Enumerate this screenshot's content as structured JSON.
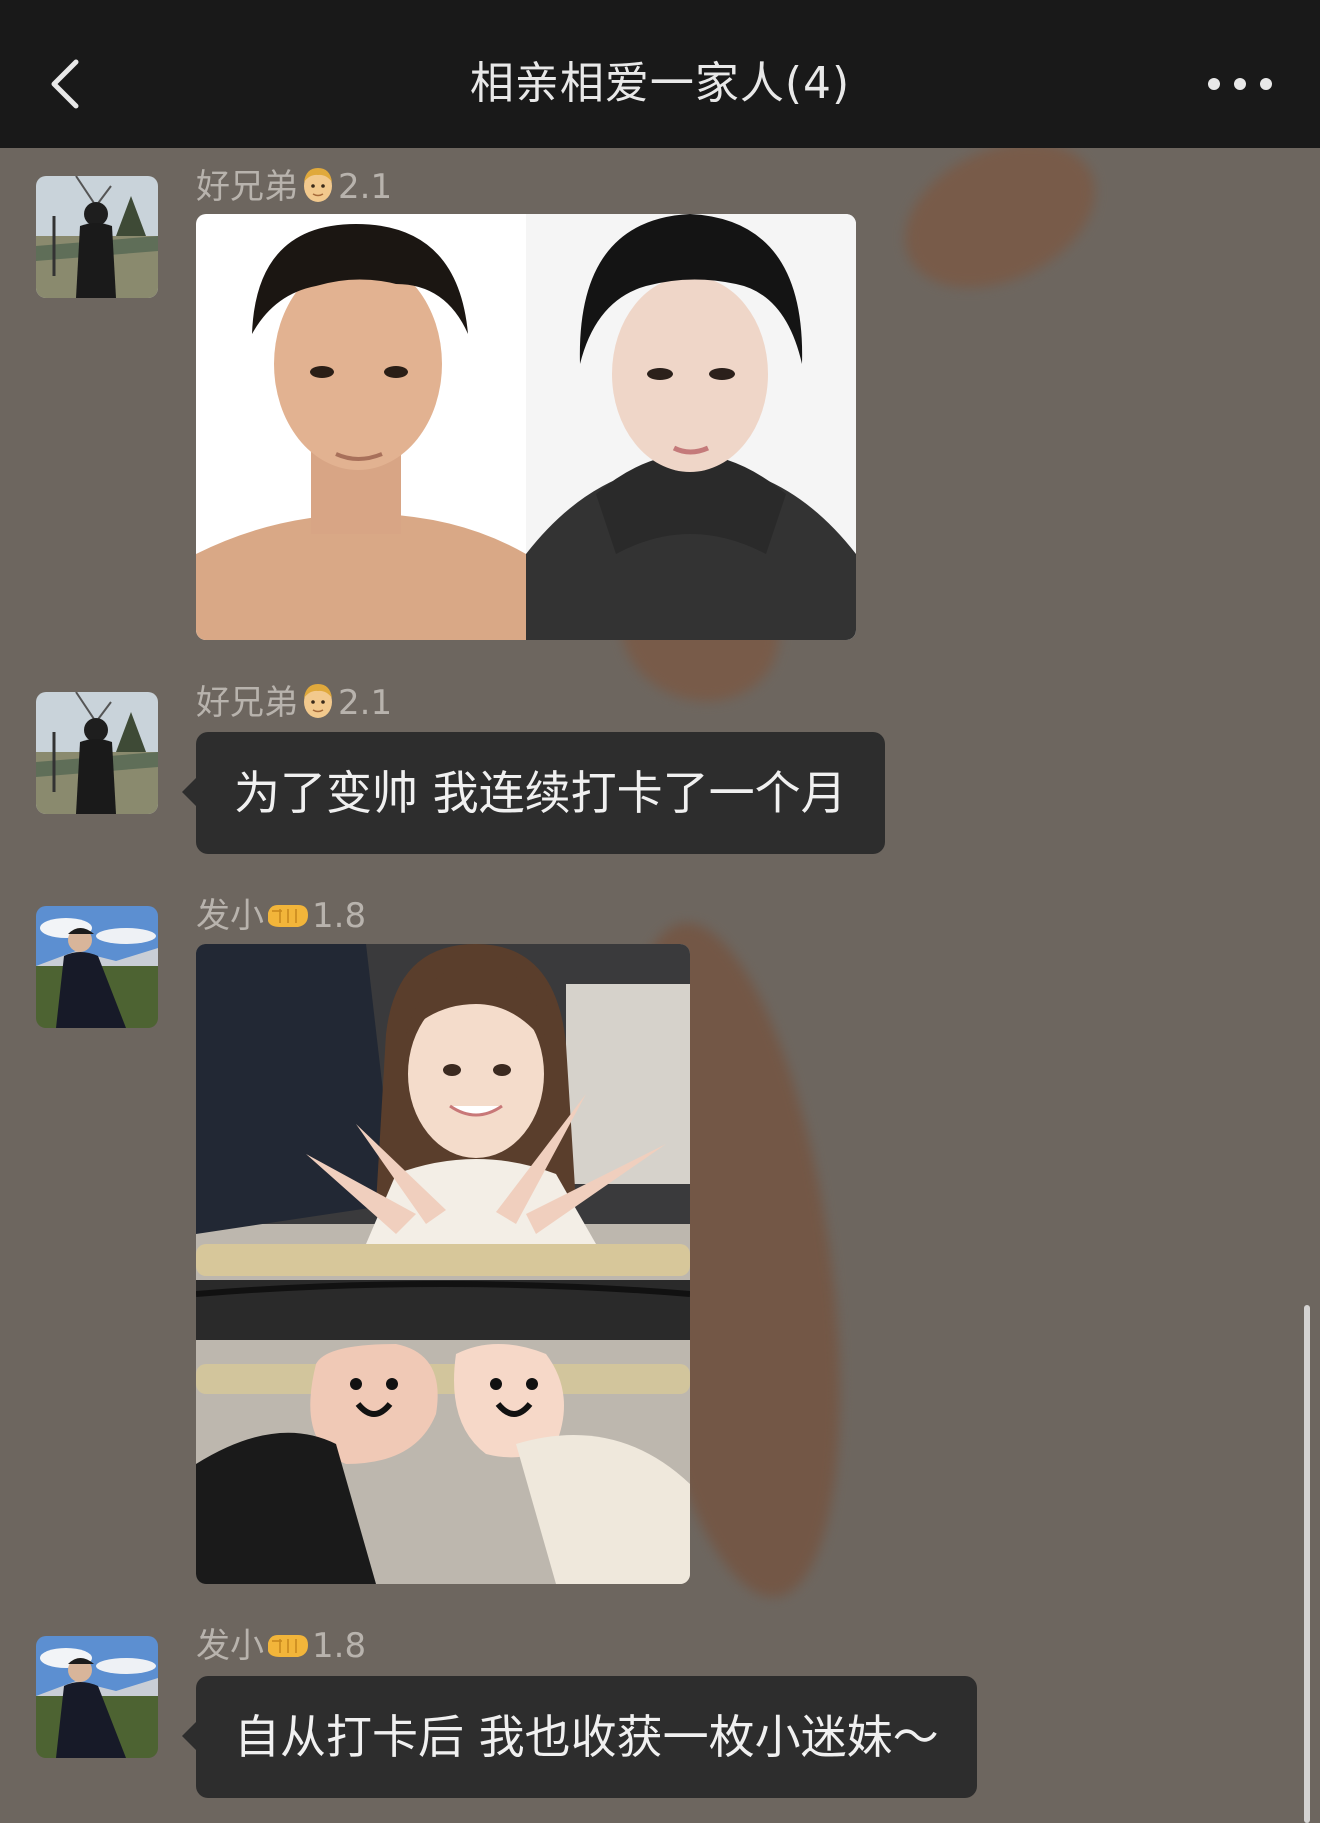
{
  "header": {
    "title": "相亲相爱一家人(4)",
    "back_icon": "chevron-left-icon",
    "more_icon": "ellipsis-icon"
  },
  "colors": {
    "top_bar": "#191919",
    "chat_background": "#6d665f",
    "bubble": "#2d2d2d",
    "bubble_text": "#f0f0f0",
    "sender_text": "#b8b3ad"
  },
  "messages": [
    {
      "type": "image",
      "sender": {
        "name": "好兄弟",
        "emoji": "man-face-emoji",
        "score": "2.1"
      },
      "image": "before-after-portrait-photo"
    },
    {
      "type": "text",
      "sender": {
        "name": "好兄弟",
        "emoji": "man-face-emoji",
        "score": "2.1"
      },
      "text": "为了变帅 我连续打卡了一个月"
    },
    {
      "type": "image",
      "sender": {
        "name": "发小",
        "emoji": "left-facing-fist-emoji",
        "score": "1.8"
      },
      "image": "couple-photo"
    },
    {
      "type": "text",
      "sender": {
        "name": "发小",
        "emoji": "left-facing-fist-emoji",
        "score": "1.8"
      },
      "text": "自从打卡后 我也收获一枚小迷妹～"
    }
  ]
}
